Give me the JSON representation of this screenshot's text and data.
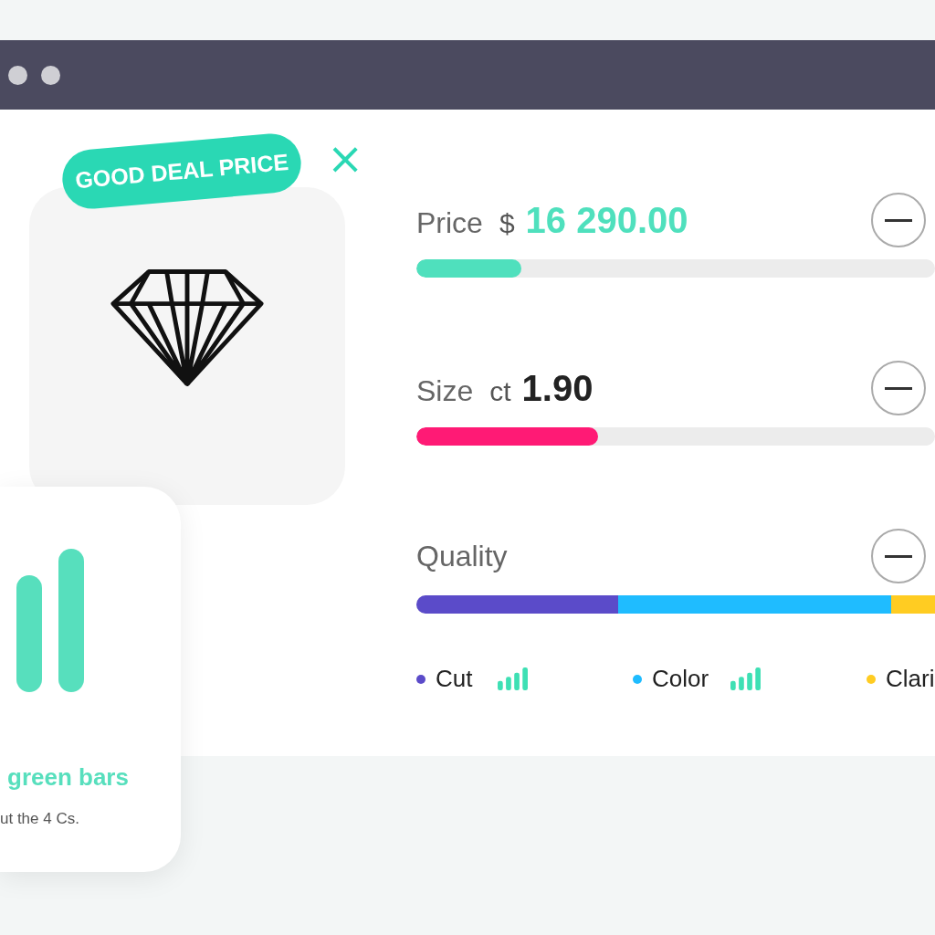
{
  "product": {
    "badge": "GOOD DEAL PRICE",
    "close": "×"
  },
  "filters": [
    {
      "kind": "range",
      "label": "Price",
      "unit": "$",
      "value": "16 290.00",
      "highlighted": true,
      "color": "#4fe0bd",
      "level": 0.2025
    },
    {
      "kind": "range",
      "label": "Size",
      "unit": "ct",
      "value": "1.90",
      "highlighted": false,
      "color": "#ff1a75",
      "level": 0.35
    },
    {
      "kind": "segments",
      "label": "Quality",
      "segments": [
        {
          "name": "Cut",
          "color": "#5b4bc9"
        },
        {
          "name": "Color",
          "color": "#1fbcff"
        },
        {
          "name": "Clari",
          "color": "#ffcc22"
        }
      ]
    }
  ],
  "tip": {
    "title": "green bars",
    "text": "ut the 4 Cs."
  }
}
